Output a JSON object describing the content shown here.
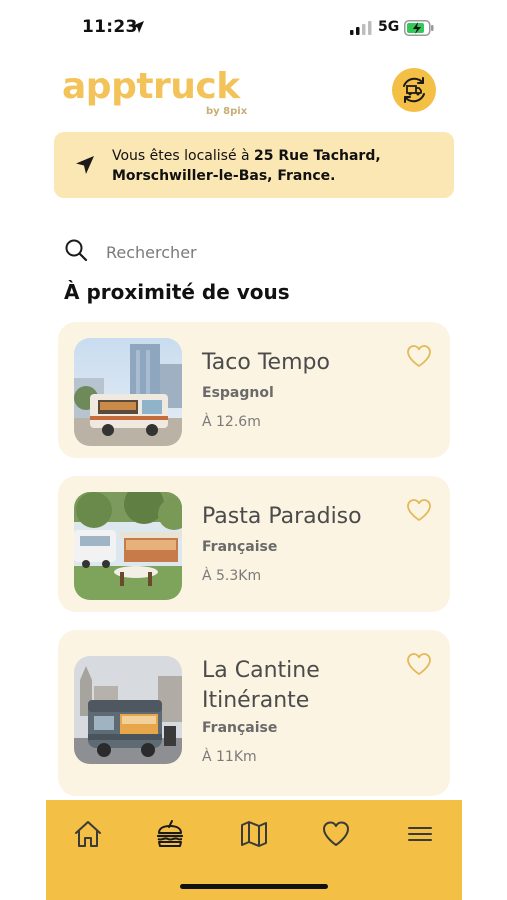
{
  "status_bar": {
    "time": "11:23",
    "network": "5G",
    "icons": [
      "location-arrow-icon",
      "signal-bars-icon",
      "battery-charging-icon"
    ]
  },
  "header": {
    "logo_text": "apptruck",
    "logo_subtitle": "by 8pix",
    "switch_icon": "truck-swap-icon"
  },
  "location": {
    "prefix": "Vous êtes localisé à ",
    "street": "25 Rue Tachard,",
    "city": "Morschwiller-le-Bas, France.",
    "icon": "navigation-arrow-icon"
  },
  "search": {
    "placeholder": "Rechercher",
    "value": ""
  },
  "section": {
    "title": "À proximité de vous"
  },
  "trucks": [
    {
      "name": "Taco Tempo",
      "cuisine": "Espagnol",
      "distance": "À 12.6m",
      "favorite": false
    },
    {
      "name": "Pasta Paradiso",
      "cuisine": "Française",
      "distance": "À 5.3Km",
      "favorite": false
    },
    {
      "name": "La Cantine Itinérante",
      "cuisine": "Française",
      "distance": "À 11Km",
      "favorite": false
    }
  ],
  "tab_bar": {
    "active": "food-trucks",
    "tabs": [
      "home-icon",
      "burger-icon",
      "map-icon",
      "heart-icon",
      "menu-icon"
    ]
  },
  "colors": {
    "accent": "#f3bf44",
    "logo": "#f3c35a",
    "banner": "#fbe7b3",
    "card": "#fbf4e2",
    "heart": "#e3b95a"
  }
}
